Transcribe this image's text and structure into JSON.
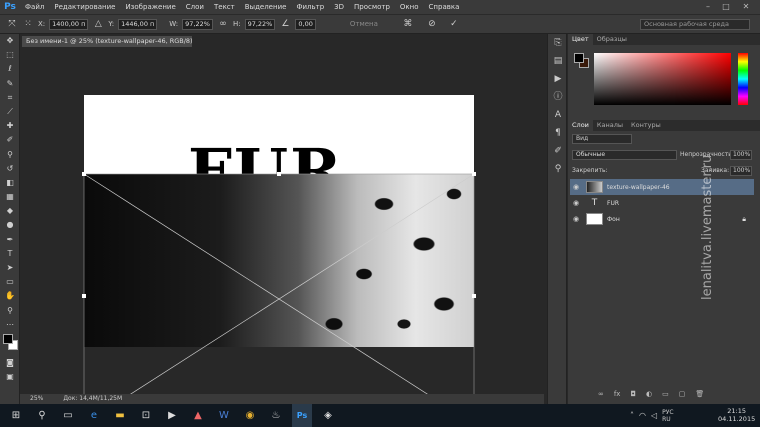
{
  "app": {
    "logo": "Ps"
  },
  "menu": [
    "Файл",
    "Редактирование",
    "Изображение",
    "Слои",
    "Текст",
    "Выделение",
    "Фильтр",
    "3D",
    "Просмотр",
    "Окно",
    "Справка"
  ],
  "options": {
    "x_label": "X:",
    "x_value": "1400,00 п",
    "y_label": "Y:",
    "y_value": "1446,00 п",
    "w_label": "W:",
    "w_value": "97,22%",
    "h_label": "H:",
    "h_value": "97,22%",
    "angle_value": "0,00",
    "interp_label": "Отмена",
    "workspace": "Основная рабочая среда"
  },
  "document": {
    "tab_title": "Без имени-1 @ 25% (texture-wallpaper-46, RGB/8) *",
    "text_layer_text": "FUR"
  },
  "status": {
    "zoom": "25%",
    "doc_info": "Док: 14,4M/11,25M"
  },
  "color_panel": {
    "tabs": [
      "Цвет",
      "Образцы"
    ]
  },
  "layers_panel": {
    "tabs": [
      "Слои",
      "Каналы",
      "Контуры"
    ],
    "filter_label": "Вид",
    "blend_mode": "Обычные",
    "opacity_label": "Непрозрачность:",
    "opacity_value": "100%",
    "lock_label": "Закрепить:",
    "fill_label": "Заливка:",
    "fill_value": "100%",
    "layers": [
      {
        "name": "texture-wallpaper-46"
      },
      {
        "name": "FUR"
      },
      {
        "name": "Фон"
      }
    ]
  },
  "taskbar": {
    "lang": "РУС\nRU",
    "time": "21:15",
    "date": "04.11.2015"
  },
  "watermark": "lenalitva.livemaster.ru"
}
